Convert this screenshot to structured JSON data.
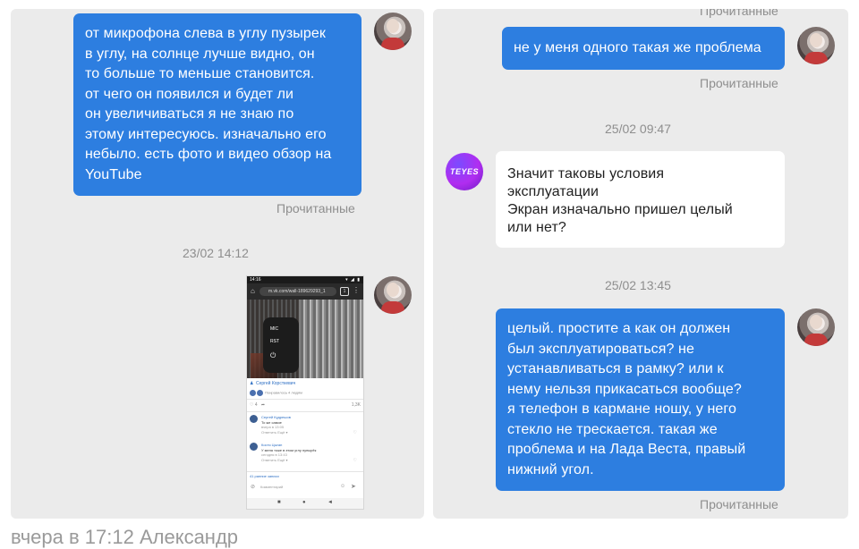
{
  "left_panel": {
    "messages": [
      {
        "type": "outgoing_text",
        "lines": [
          "от микрофона слева в углу пузырек",
          "в углу, на солнце лучше видно, он",
          "то больше то меньше становится.",
          "от чего он появился и будет ли",
          "он увеличиваться я не знаю по",
          "этому интересуюсь. изначально его",
          "небыло. есть фото и видео обзор на",
          "YouTube"
        ],
        "status": "Прочитанные"
      }
    ],
    "date_separator": "23/02 14:12",
    "image_message": {
      "phone_screen": {
        "status_time": "14:16",
        "status_icons": "▾ ◢ ▮",
        "url": "m.vk.com/wall-189629293_1",
        "home_icon": "⌂",
        "tabs_count": "1",
        "menu_icon": "⋮",
        "photo_buttons": [
          "MIC",
          "RST",
          "⏻"
        ],
        "post_author": "Сергей Корсткевич",
        "likes_text": "Понравилось 4 людям",
        "like_count": "4",
        "views": "1,3K",
        "comments": [
          {
            "name": "Сергей Кудрешов",
            "text": "То же самое",
            "meta": "вчера в 13:05",
            "actions": "Ответить   Ещё ▾"
          },
          {
            "name": "Костя Цыган",
            "text": "У меня тоже в этом углу пупырёк",
            "meta": "сегодня в 13:43",
            "actions": "Ответить   Ещё ▾"
          }
        ],
        "more_comments": "41 ранние записи",
        "compose_placeholder": "Комментарий",
        "nav_icons": [
          "■",
          "●",
          "◄"
        ]
      }
    }
  },
  "right_panel": {
    "top_status": "Прочитанные",
    "messages": [
      {
        "type": "outgoing_text",
        "lines": [
          "не у меня одного такая же проблема"
        ],
        "status": "Прочитанные"
      },
      {
        "type": "date",
        "text": "25/02 09:47"
      },
      {
        "type": "incoming_text",
        "sender_logo": "TEYES",
        "lines": [
          "Значит таковы условия",
          "эксплуатации",
          "Экран изначально пришел целый",
          "или нет?"
        ]
      },
      {
        "type": "date",
        "text": "25/02 13:45"
      },
      {
        "type": "outgoing_text",
        "lines": [
          "целый. простите а как он должен",
          "был эксплуатироваться? не",
          "устанавливаться в рамку? или к",
          "нему нельзя прикасаться вообще?",
          "я телефон в кармане ношу, у него",
          "стекло не трескается. такая же",
          "проблема и на Лада Веста, правый",
          "нижний угол."
        ],
        "status": "Прочитанные"
      }
    ]
  },
  "footer_text": "вчера в 17:12 Александр",
  "colors": {
    "outgoing_bubble": "#2d7ee0",
    "incoming_bubble": "#ffffff",
    "panel_bg": "#ebebeb",
    "status_text": "#8e8e8e"
  }
}
